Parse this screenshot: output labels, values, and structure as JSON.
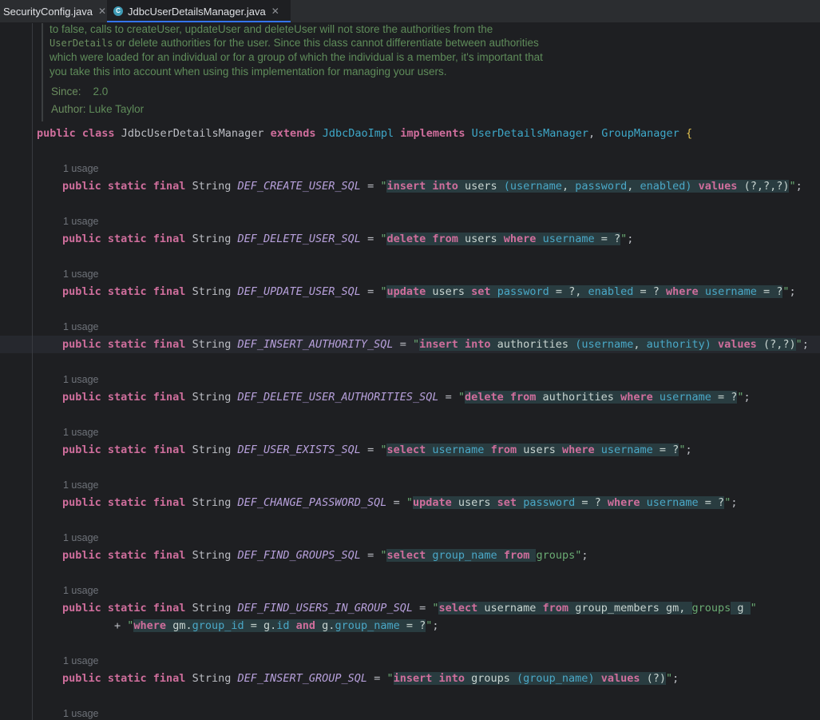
{
  "tabs": [
    {
      "label": "SecurityConfig.java",
      "active": false
    },
    {
      "label": "JdbcUserDetailsManager.java",
      "active": true
    }
  ],
  "doc": {
    "lines": [
      "to false, calls to createUser, updateUser and deleteUser will not store the authorities from the",
      "UserDetails",
      " or delete authorities for the user. Since this class cannot differentiate between authorities",
      "which were loaded for an individual or for a group of which the individual is a member, it's important that",
      "you take this into account when using this implementation for managing your users."
    ],
    "since_label": "Since:",
    "since_value": "2.0",
    "author_label": "Author:",
    "author_value": "Luke Taylor"
  },
  "class_decl": {
    "public": "public",
    "class": "class",
    "name": "JdbcUserDetailsManager",
    "extends": "extends",
    "super": "JdbcDaoImpl",
    "implements": "implements",
    "iface1": "UserDetailsManager",
    "comma": ",",
    "iface2": "GroupManager",
    "brace": "{"
  },
  "usage_hint": "1 usage",
  "modifiers": "public static final",
  "type": "String",
  "fields": [
    {
      "name": "DEF_CREATE_USER_SQL"
    },
    {
      "name": "DEF_DELETE_USER_SQL"
    },
    {
      "name": "DEF_UPDATE_USER_SQL"
    },
    {
      "name": "DEF_INSERT_AUTHORITY_SQL"
    },
    {
      "name": "DEF_DELETE_USER_AUTHORITIES_SQL"
    },
    {
      "name": "DEF_USER_EXISTS_SQL"
    },
    {
      "name": "DEF_CHANGE_PASSWORD_SQL"
    },
    {
      "name": "DEF_FIND_GROUPS_SQL"
    },
    {
      "name": "DEF_FIND_USERS_IN_GROUP_SQL"
    },
    {
      "name": "DEF_INSERT_GROUP_SQL"
    }
  ],
  "colors": {
    "background": "#1e1f22",
    "keyword": "#cf6e9c",
    "constant": "#b7a0db",
    "class_ref": "#3ea8c9",
    "string": "#6aab73",
    "doc_comment": "#5f8c5a",
    "sql_injection_bg": "#293c40"
  }
}
